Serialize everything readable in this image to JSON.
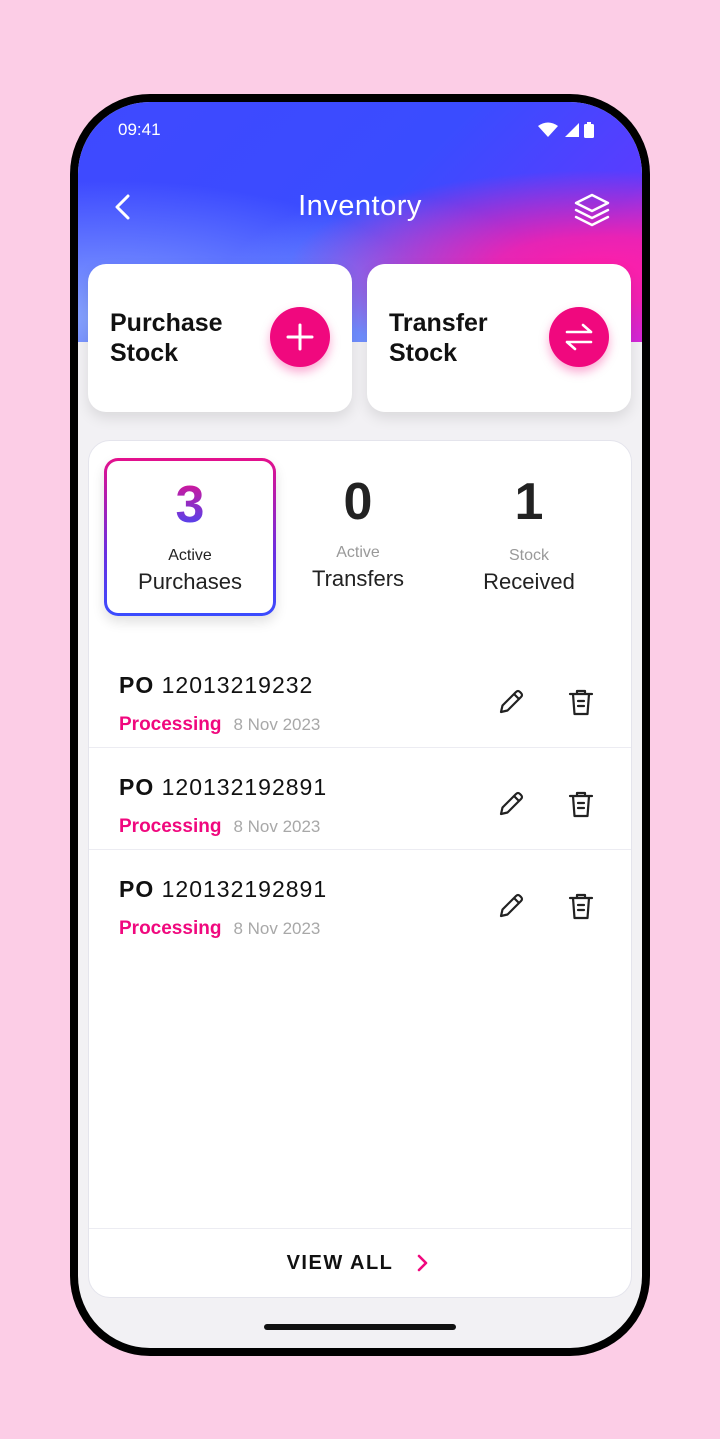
{
  "status_bar": {
    "time": "09:41"
  },
  "header": {
    "title": "Inventory"
  },
  "actions": {
    "purchase": {
      "label_line1": "Purchase",
      "label_line2": "Stock"
    },
    "transfer": {
      "label_line1": "Transfer",
      "label_line2": "Stock"
    }
  },
  "stats": [
    {
      "count": "3",
      "sub": "Active",
      "main": "Purchases",
      "selected": true
    },
    {
      "count": "0",
      "sub": "Active",
      "main": "Transfers",
      "selected": false
    },
    {
      "count": "1",
      "sub": "Stock",
      "main": "Received",
      "selected": false
    }
  ],
  "orders": [
    {
      "prefix": "PO",
      "number": "12013219232",
      "status": "Processing",
      "date": "8 Nov 2023"
    },
    {
      "prefix": "PO",
      "number": "120132192891",
      "status": "Processing",
      "date": "8 Nov 2023"
    },
    {
      "prefix": "PO",
      "number": "120132192891",
      "status": "Processing",
      "date": "8 Nov 2023"
    }
  ],
  "footer": {
    "view_all": "VIEW ALL"
  },
  "colors": {
    "accent": "#f0087e",
    "primary": "#3a4cff",
    "background": "#fccde6"
  }
}
